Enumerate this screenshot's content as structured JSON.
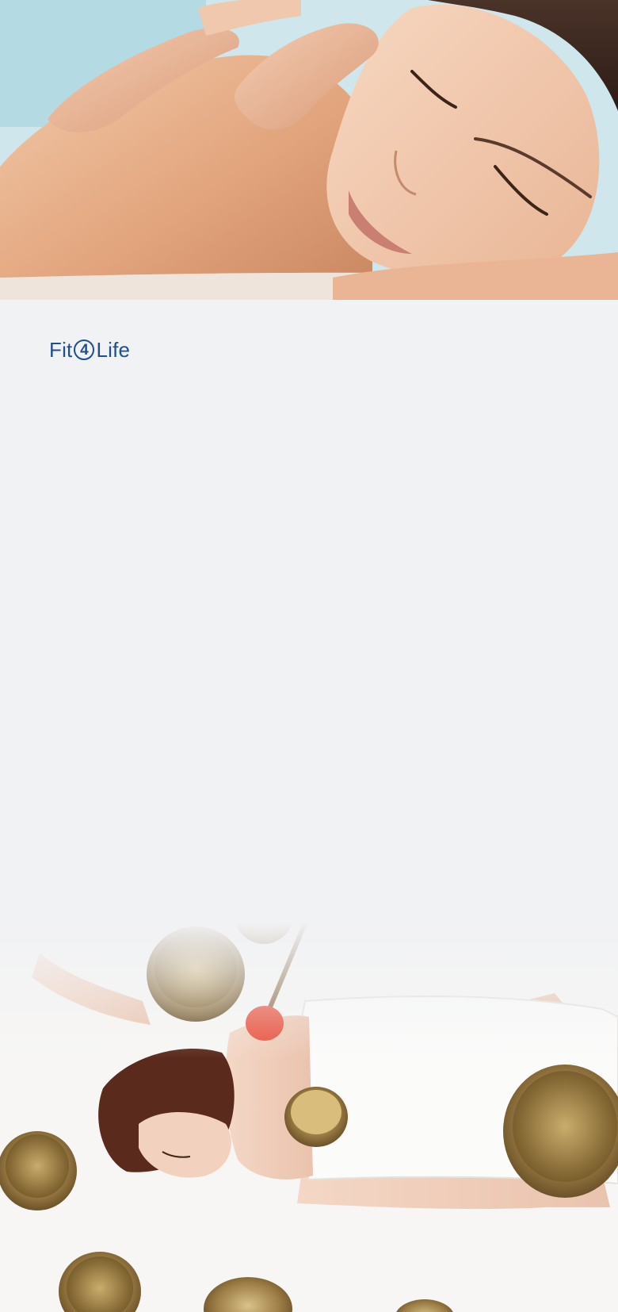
{
  "brand": {
    "prefix": "Fit",
    "number": "4",
    "suffix": "Life",
    "color": "#1d4f91"
  },
  "images": {
    "hero": {
      "subject": "massage-photo"
    },
    "bottom": {
      "subject": "singing-bowls-photo"
    }
  },
  "colors": {
    "page_background": "#f1f2f4",
    "brand_blue": "#1d4f91"
  }
}
